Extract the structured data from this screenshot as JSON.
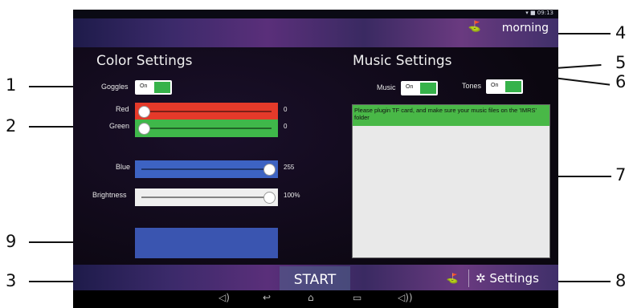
{
  "status_bar": {
    "text": "▾ ■ 09:13"
  },
  "profile": {
    "label": "morning",
    "icon": "sunrise-icon"
  },
  "color_settings": {
    "title": "Color Settings",
    "goggles_label": "Goggles",
    "goggles_toggle": "On",
    "sliders": [
      {
        "label": "Red",
        "value_text": "0",
        "value": 0,
        "max": 255,
        "color": "#e53a2a"
      },
      {
        "label": "Green",
        "value_text": "0",
        "value": 0,
        "max": 255,
        "color": "#3fb84a"
      },
      {
        "label": "Blue",
        "value_text": "255",
        "value": 255,
        "max": 255,
        "color": "#3d63c3"
      },
      {
        "label": "Brightness",
        "value_text": "100%",
        "value": 100,
        "max": 100,
        "color": "#efefef"
      }
    ],
    "preview_color": "#3a55b0"
  },
  "music_settings": {
    "title": "Music Settings",
    "music_label": "Music",
    "music_toggle": "On",
    "tones_label": "Tones",
    "tones_toggle": "On",
    "message": "Please plugin TF card, and make sure your music files on the 'IMRS' folder"
  },
  "bottom_bar": {
    "start": "START",
    "settings": "Settings",
    "settings_icon": "gear-icon",
    "profile_icon": "sunrise-icon"
  },
  "nav_bar": {
    "icons": [
      "volume-down-icon",
      "back-icon",
      "home-icon",
      "recents-icon",
      "volume-up-icon"
    ]
  },
  "callouts": [
    "1",
    "2",
    "3",
    "4",
    "5",
    "6",
    "7",
    "8",
    "9"
  ]
}
